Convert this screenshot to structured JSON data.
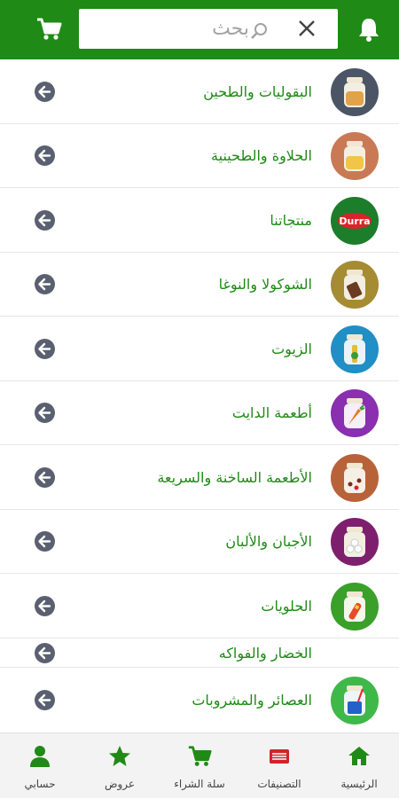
{
  "header": {
    "search_placeholder": "بحث",
    "icons": {
      "cart": "cart-icon",
      "bell": "bell-icon",
      "clear": "close-icon",
      "search": "search-icon"
    }
  },
  "categories": [
    {
      "label": "البقوليات والطحين",
      "icon": "legumes-jar-icon"
    },
    {
      "label": "الحلاوة والطحينية",
      "icon": "halva-jar-icon"
    },
    {
      "label": "منتجاتنا",
      "icon": "durra-logo"
    },
    {
      "label": "الشوكولا والنوغا",
      "icon": "chocolate-jar-icon"
    },
    {
      "label": "الزيوت",
      "icon": "oil-jar-icon"
    },
    {
      "label": "أطعمة الدايت",
      "icon": "diet-jar-icon"
    },
    {
      "label": "الأطعمة الساخنة والسريعة",
      "icon": "hot-food-jar-icon"
    },
    {
      "label": "الأجبان والألبان",
      "icon": "dairy-jar-icon"
    },
    {
      "label": "الحلويات",
      "icon": "sweets-jar-icon"
    },
    {
      "label": "الخضار والفواكه",
      "icon": ""
    },
    {
      "label": "العصائر والمشروبات",
      "icon": "juice-jar-icon"
    }
  ],
  "logo_text": "Durra",
  "nav": [
    {
      "label": "الرئيسية",
      "icon": "home-icon",
      "color": "#1f8a16"
    },
    {
      "label": "التصنيفات",
      "icon": "categories-icon",
      "color": "#d0232a"
    },
    {
      "label": "سلة الشراء",
      "icon": "cart-icon",
      "color": "#1f8a16"
    },
    {
      "label": "عروض",
      "icon": "star-icon",
      "color": "#1f8a16"
    },
    {
      "label": "حسابي",
      "icon": "user-icon",
      "color": "#1f8a16"
    }
  ],
  "colors": {
    "brand_green": "#1f8a16",
    "arrow_gray": "#5a6070",
    "nav_bg": "#f3f3f3"
  }
}
